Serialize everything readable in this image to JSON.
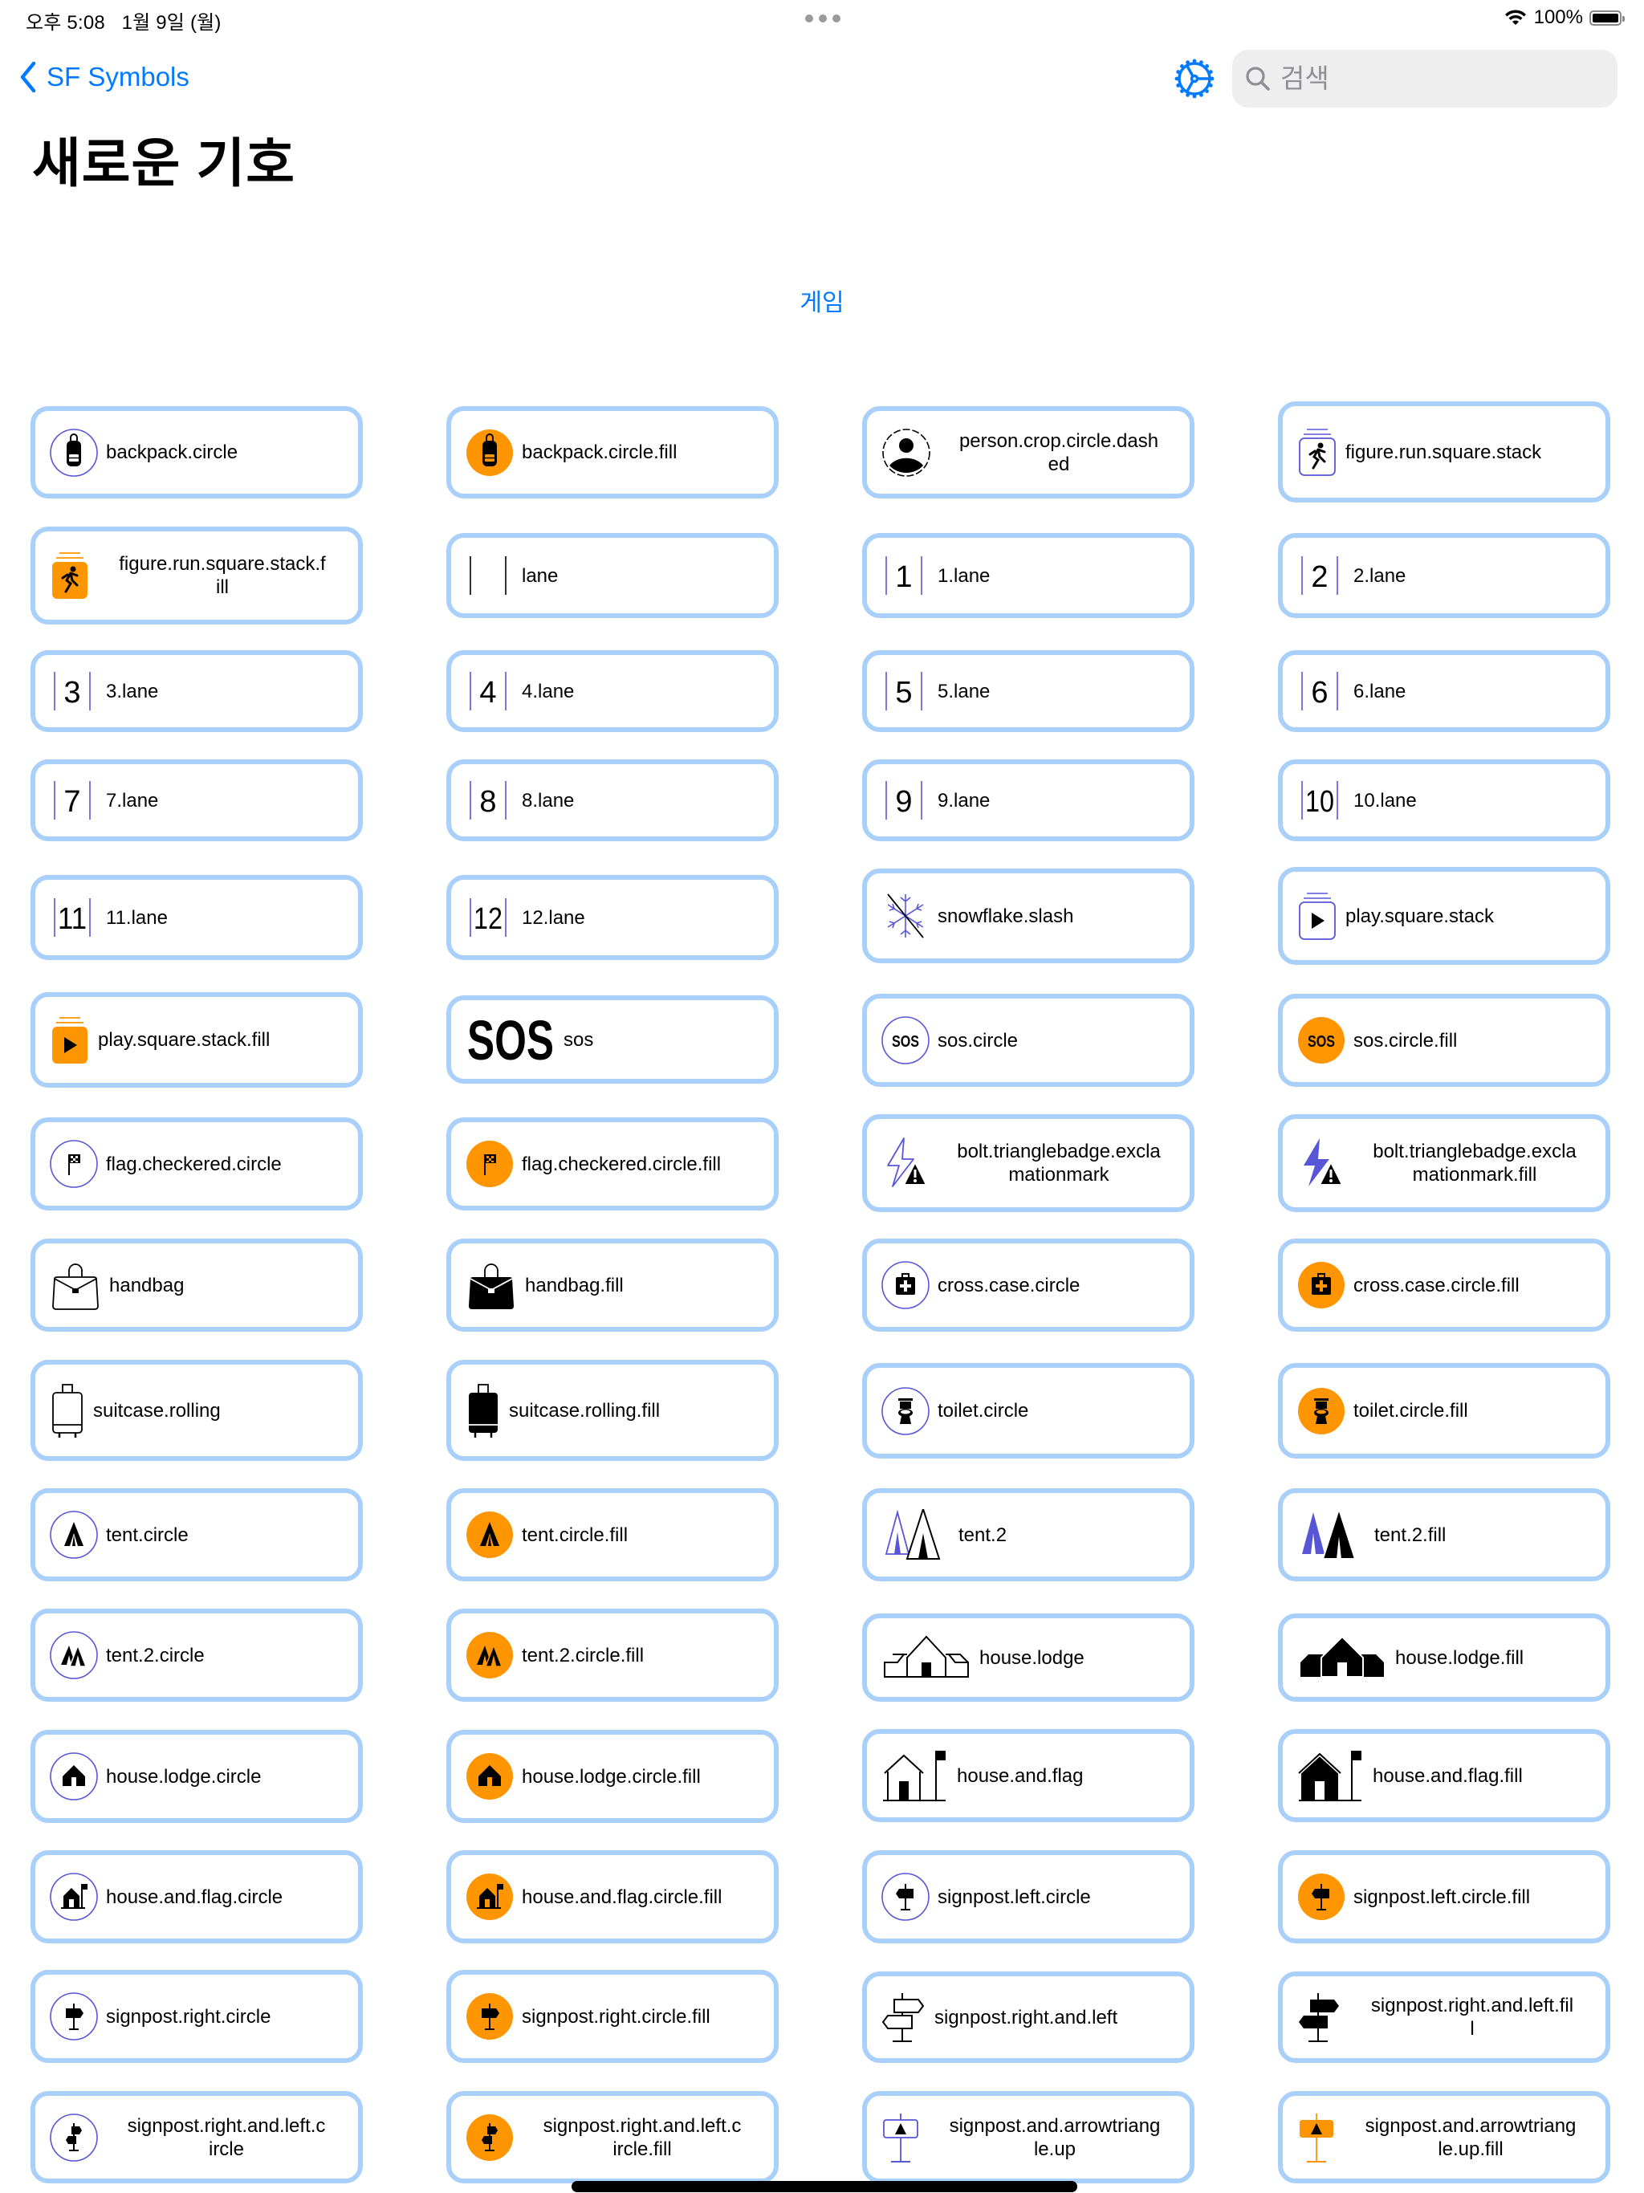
{
  "status_bar": {
    "time": "오후 5:08",
    "date": "1월 9일 (월)",
    "battery_text": "100%",
    "battery_level_percent": 100
  },
  "nav": {
    "back_label": "SF Symbols",
    "search_placeholder": "검색",
    "search_value": ""
  },
  "page_title": "새로운 기호",
  "section_label": "게임",
  "colors": {
    "accent": "#007AFF",
    "secondary": "#5856D6",
    "fill": "#FF9500",
    "card_border": "#A9D0FA"
  },
  "symbols": [
    {
      "name": "backpack.circle",
      "icon": "backpack-circle-icon"
    },
    {
      "name": "backpack.circle.fill",
      "icon": "backpack-circle-fill-icon"
    },
    {
      "name": "person.crop.circle.dash ed",
      "icon": "person-crop-circle-dashed-icon"
    },
    {
      "name": "figure.run.square.stack",
      "icon": "figure-run-square-stack-icon"
    },
    {
      "name": "figure.run.square.stack.f ill",
      "icon": "figure-run-square-stack-fill-icon"
    },
    {
      "name": "lane",
      "icon": "lane-icon",
      "num": ""
    },
    {
      "name": "1.lane",
      "icon": "lane-1-icon",
      "num": "1"
    },
    {
      "name": "2.lane",
      "icon": "lane-2-icon",
      "num": "2"
    },
    {
      "name": "3.lane",
      "icon": "lane-3-icon",
      "num": "3"
    },
    {
      "name": "4.lane",
      "icon": "lane-4-icon",
      "num": "4"
    },
    {
      "name": "5.lane",
      "icon": "lane-5-icon",
      "num": "5"
    },
    {
      "name": "6.lane",
      "icon": "lane-6-icon",
      "num": "6"
    },
    {
      "name": "7.lane",
      "icon": "lane-7-icon",
      "num": "7"
    },
    {
      "name": "8.lane",
      "icon": "lane-8-icon",
      "num": "8"
    },
    {
      "name": "9.lane",
      "icon": "lane-9-icon",
      "num": "9"
    },
    {
      "name": "10.lane",
      "icon": "lane-10-icon",
      "num": "10"
    },
    {
      "name": "11.lane",
      "icon": "lane-11-icon",
      "num": "11"
    },
    {
      "name": "12.lane",
      "icon": "lane-12-icon",
      "num": "12"
    },
    {
      "name": "snowflake.slash",
      "icon": "snowflake-slash-icon"
    },
    {
      "name": "play.square.stack",
      "icon": "play-square-stack-icon"
    },
    {
      "name": "play.square.stack.fill",
      "icon": "play-square-stack-fill-icon"
    },
    {
      "name": "sos",
      "icon": "sos-icon",
      "glyph": "SOS"
    },
    {
      "name": "sos.circle",
      "icon": "sos-circle-icon",
      "glyph": "SOS"
    },
    {
      "name": "sos.circle.fill",
      "icon": "sos-circle-fill-icon",
      "glyph": "SOS"
    },
    {
      "name": "flag.checkered.circle",
      "icon": "flag-checkered-circle-icon"
    },
    {
      "name": "flag.checkered.circle.fill",
      "icon": "flag-checkered-circle-fill-icon"
    },
    {
      "name": "bolt.trianglebadge.excla mationmark",
      "icon": "bolt-trianglebadge-exclamationmark-icon"
    },
    {
      "name": "bolt.trianglebadge.excla mationmark.fill",
      "icon": "bolt-trianglebadge-exclamationmark-fill-icon"
    },
    {
      "name": "handbag",
      "icon": "handbag-icon"
    },
    {
      "name": "handbag.fill",
      "icon": "handbag-fill-icon"
    },
    {
      "name": "cross.case.circle",
      "icon": "cross-case-circle-icon"
    },
    {
      "name": "cross.case.circle.fill",
      "icon": "cross-case-circle-fill-icon"
    },
    {
      "name": "suitcase.rolling",
      "icon": "suitcase-rolling-icon"
    },
    {
      "name": "suitcase.rolling.fill",
      "icon": "suitcase-rolling-fill-icon"
    },
    {
      "name": "toilet.circle",
      "icon": "toilet-circle-icon"
    },
    {
      "name": "toilet.circle.fill",
      "icon": "toilet-circle-fill-icon"
    },
    {
      "name": "tent.circle",
      "icon": "tent-circle-icon"
    },
    {
      "name": "tent.circle.fill",
      "icon": "tent-circle-fill-icon"
    },
    {
      "name": "tent.2",
      "icon": "tent-2-icon"
    },
    {
      "name": "tent.2.fill",
      "icon": "tent-2-fill-icon"
    },
    {
      "name": "tent.2.circle",
      "icon": "tent-2-circle-icon"
    },
    {
      "name": "tent.2.circle.fill",
      "icon": "tent-2-circle-fill-icon"
    },
    {
      "name": "house.lodge",
      "icon": "house-lodge-icon"
    },
    {
      "name": "house.lodge.fill",
      "icon": "house-lodge-fill-icon"
    },
    {
      "name": "house.lodge.circle",
      "icon": "house-lodge-circle-icon"
    },
    {
      "name": "house.lodge.circle.fill",
      "icon": "house-lodge-circle-fill-icon"
    },
    {
      "name": "house.and.flag",
      "icon": "house-and-flag-icon"
    },
    {
      "name": "house.and.flag.fill",
      "icon": "house-and-flag-fill-icon"
    },
    {
      "name": "house.and.flag.circle",
      "icon": "house-and-flag-circle-icon"
    },
    {
      "name": "house.and.flag.circle.fill",
      "icon": "house-and-flag-circle-fill-icon"
    },
    {
      "name": "signpost.left.circle",
      "icon": "signpost-left-circle-icon"
    },
    {
      "name": "signpost.left.circle.fill",
      "icon": "signpost-left-circle-fill-icon"
    },
    {
      "name": "signpost.right.circle",
      "icon": "signpost-right-circle-icon"
    },
    {
      "name": "signpost.right.circle.fill",
      "icon": "signpost-right-circle-fill-icon"
    },
    {
      "name": "signpost.right.and.left",
      "icon": "signpost-right-and-left-icon"
    },
    {
      "name": "signpost.right.and.left.fil l",
      "icon": "signpost-right-and-left-fill-icon"
    },
    {
      "name": "signpost.right.and.left.c ircle",
      "icon": "signpost-right-and-left-circle-icon"
    },
    {
      "name": "signpost.right.and.left.c ircle.fill",
      "icon": "signpost-right-and-left-circle-fill-icon"
    },
    {
      "name": "signpost.and.arrowtriang le.up",
      "icon": "signpost-and-arrowtriangle-up-icon"
    },
    {
      "name": "signpost.and.arrowtriang le.up.fill",
      "icon": "signpost-and-arrowtriangle-up-fill-icon"
    }
  ]
}
